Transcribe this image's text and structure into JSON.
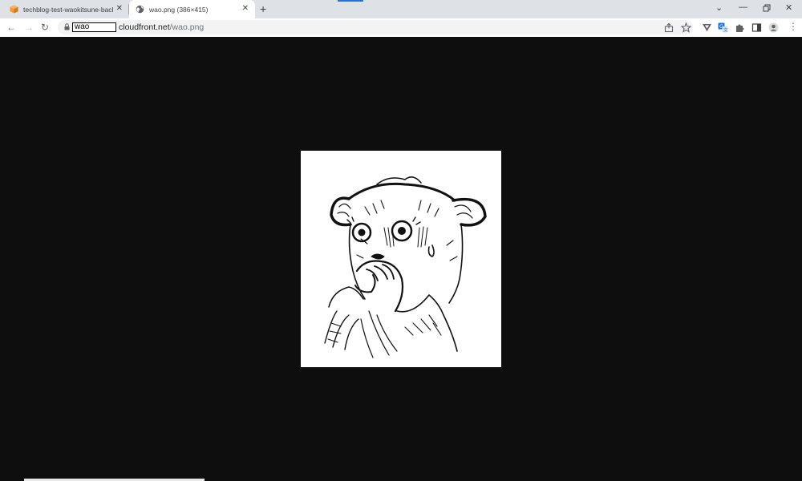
{
  "tabs": [
    {
      "title": "techblog-test-waokitsune-backend",
      "icon": "aws-cube-icon",
      "active": false
    },
    {
      "title": "wao.png (386×415)",
      "icon": "globe-icon",
      "active": true
    }
  ],
  "address_bar": {
    "redacted_subdomain": "wao",
    "host": "cloudfront.net",
    "path": "/wao.png"
  },
  "colors": {
    "tabbar_bg": "#dee1e6",
    "page_bg": "#0e0e0e",
    "tab_favicon_orange": "#f39c34",
    "loading_bar": "#1a73e8",
    "translate_icon": "#1a73e8"
  },
  "image": {
    "alt": "wao.png"
  }
}
